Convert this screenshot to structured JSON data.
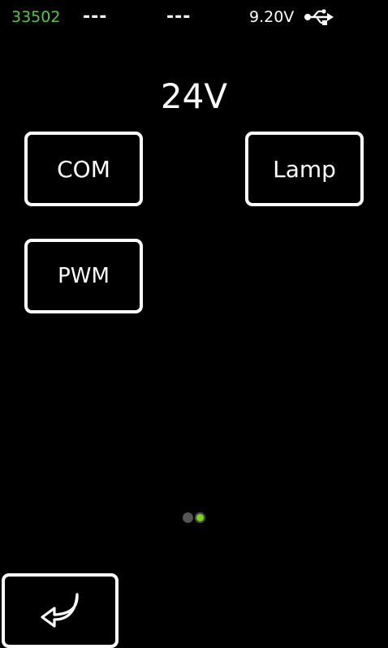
{
  "status": {
    "device_id": "33502",
    "field_1": "---",
    "field_2": "---",
    "supply_voltage": "9.20V",
    "connection_icon": "usb-icon"
  },
  "screen": {
    "title": "24V"
  },
  "tiles": [
    {
      "label": "COM"
    },
    {
      "label": "Lamp"
    },
    {
      "label": "PWM"
    }
  ],
  "pager": {
    "pages": 2,
    "current": 2,
    "active_color": "#7ed321",
    "inactive_color": "#555555"
  },
  "footer": {
    "back_icon": "back-arrow-icon"
  },
  "colors": {
    "background": "#000000",
    "accent_green": "#5cc63a",
    "foreground": "#ffffff"
  }
}
